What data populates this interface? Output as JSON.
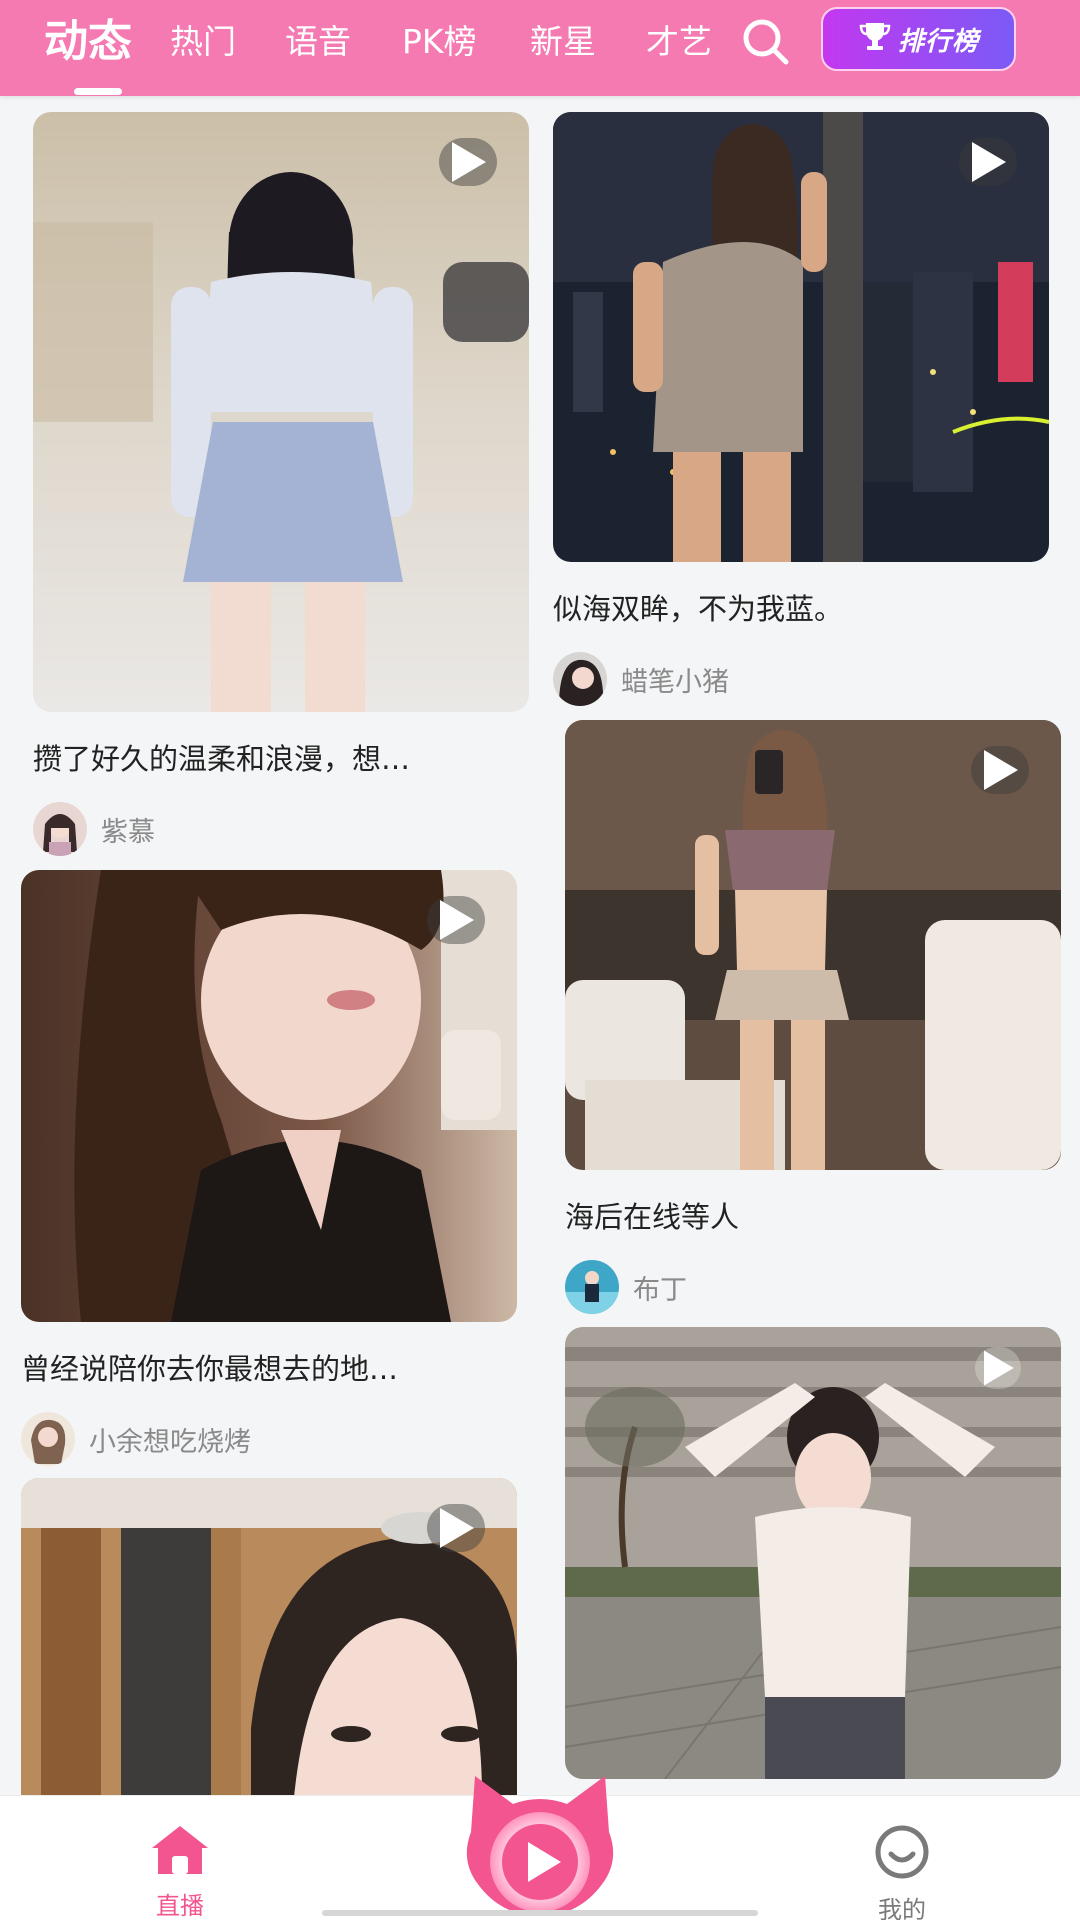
{
  "header": {
    "tabs": [
      {
        "label": "动态",
        "active": true
      },
      {
        "label": "热门",
        "active": false
      },
      {
        "label": "语音",
        "active": false
      },
      {
        "label": "PK榜",
        "active": false
      },
      {
        "label": "新星",
        "active": false
      },
      {
        "label": "才艺",
        "active": false
      }
    ],
    "search_icon": "search-icon",
    "rank_button": {
      "label": "排行榜",
      "icon": "trophy-icon"
    }
  },
  "feed": {
    "left": [
      {
        "caption": "攒了好久的温柔和浪漫，想…",
        "author": "紫慕",
        "has_video": true
      },
      {
        "caption": "曾经说陪你去你最想去的地…",
        "author": "小余想吃烧烤",
        "has_video": true
      },
      {
        "caption": "",
        "author": "",
        "has_video": true
      }
    ],
    "right": [
      {
        "caption": "似海双眸，不为我蓝。",
        "author": "蜡笔小猪",
        "has_video": true
      },
      {
        "caption": "海后在线等人",
        "author": "布丁",
        "has_video": true
      },
      {
        "caption": "",
        "author": "",
        "has_video": true
      }
    ]
  },
  "bottom_nav": {
    "items": [
      {
        "label": "直播",
        "icon": "home-icon",
        "active": true
      },
      {
        "label": "",
        "icon": "play-center-icon",
        "active": false
      },
      {
        "label": "我的",
        "icon": "smile-icon",
        "active": false
      }
    ]
  },
  "colors": {
    "header_bg": "#f47ab1",
    "accent_pink": "#f2558f",
    "rank_gradient_start": "#c338f0",
    "rank_gradient_end": "#7b5af6",
    "inactive_nav": "#7a7a7a"
  }
}
